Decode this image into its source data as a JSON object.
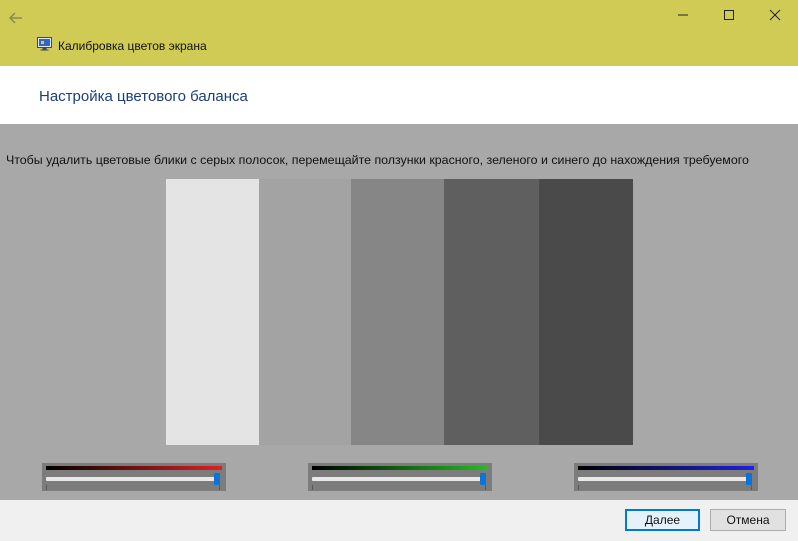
{
  "window": {
    "title": "Калибровка цветов экрана",
    "controls": {
      "minimize": "—",
      "maximize": "☐",
      "close": "✕"
    }
  },
  "header": {
    "title": "Настройка цветового баланса"
  },
  "instruction": "Чтобы удалить цветовые блики с серых полосок, перемещайте ползунки красного, зеленого и синего до нахождения требуемого",
  "gray_bars": [
    "#e4e4e4",
    "#a3a3a3",
    "#868686",
    "#5f5f5f",
    "#4a4a4a"
  ],
  "sliders": [
    {
      "channel": "red",
      "color": "#e02020",
      "value": 1.0
    },
    {
      "channel": "green",
      "color": "#20c020",
      "value": 1.0
    },
    {
      "channel": "blue",
      "color": "#2020e0",
      "value": 1.0
    }
  ],
  "footer": {
    "next_label": "Далее",
    "cancel_label": "Отмена"
  },
  "colors": {
    "titlebar": "#cfcb55",
    "title_text": "#1b3e7a",
    "thumb": "#0a74d6"
  }
}
